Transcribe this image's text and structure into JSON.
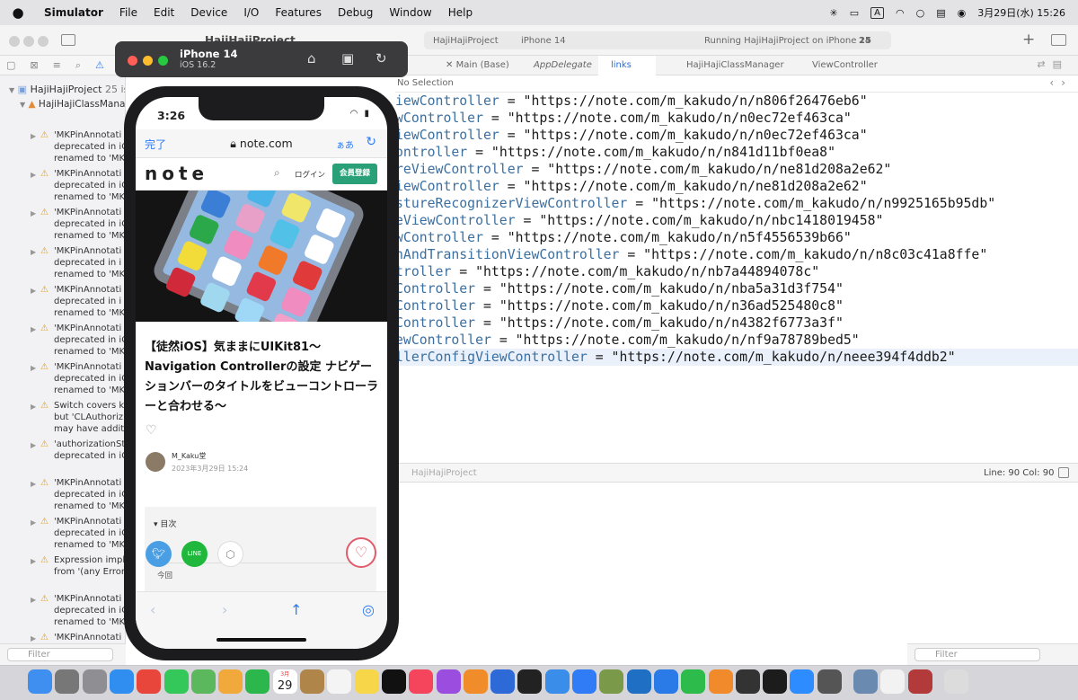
{
  "menubar": {
    "apple": "",
    "app": "Simulator",
    "items": [
      "File",
      "Edit",
      "Device",
      "I/O",
      "Features",
      "Debug",
      "Window",
      "Help"
    ],
    "input": "A",
    "datetime": "3月29日(水)  15:26"
  },
  "xcode": {
    "project": "HajiHajiProject",
    "status_scheme": "HajiHajiProject",
    "status_device": "iPhone 14",
    "status_run": "Running HajiHajiProject on iPhone 14",
    "status_warnings": "25",
    "tabs": [
      "Main (Base)",
      "AppDelegate",
      "links",
      "HajiHajiClassManager",
      "ViewController"
    ],
    "jump_no_selection": "No Selection",
    "debug_path": "HajiHajiProject",
    "line_col": "Line: 90  Col: 90",
    "filter_placeholder": "Filter"
  },
  "issues": {
    "root": "HajiHajiProject",
    "root_count": "25 issues",
    "child": "HajiHajiClassManag",
    "items": [
      {
        "l1": "'MKPinAnnotati",
        "l2": "deprecated in iO",
        "l3": "renamed to 'MK"
      },
      {
        "l1": "'MKPinAnnotati",
        "l2": "deprecated in iO",
        "l3": "renamed to 'MK"
      },
      {
        "l1": "'MKPinAnnotati",
        "l2": "deprecated in iO",
        "l3": "renamed to 'MK"
      },
      {
        "l1": "'MKPinAnnotati",
        "l2": "deprecated in i",
        "l3": "renamed to 'MK"
      },
      {
        "l1": "'MKPinAnnotati",
        "l2": "deprecated in i",
        "l3": "renamed to 'MK"
      },
      {
        "l1": "'MKPinAnnotati",
        "l2": "deprecated in iO",
        "l3": "renamed to 'MK"
      },
      {
        "l1": "'MKPinAnnotati",
        "l2": "deprecated in iO",
        "l3": "renamed to 'MK"
      },
      {
        "l1": "Switch covers k",
        "l2": "but 'CLAuthoriz",
        "l3": "may have additi"
      },
      {
        "l1": "'authorizationSt",
        "l2": "deprecated in iO",
        "l3": ""
      },
      {
        "l1": "'MKPinAnnotati",
        "l2": "deprecated in iO",
        "l3": "renamed to 'MK"
      },
      {
        "l1": "'MKPinAnnotati",
        "l2": "deprecated in iO",
        "l3": "renamed to 'MK"
      },
      {
        "l1": "Expression impl",
        "l2": "from '(any Error",
        "l3": ""
      },
      {
        "l1": "'MKPinAnnotati",
        "l2": "deprecated in iO",
        "l3": "renamed to 'MK"
      },
      {
        "l1": "'MKPinAnnotati",
        "l2": "deprecated in iO",
        "l3": "renamed to 'MK"
      },
      {
        "l1": "'MKPinAnnotati",
        "l2": "deprecated in iO",
        "l3": "renamed to 'MK"
      }
    ]
  },
  "code_lines": [
    {
      "name": "iewController",
      "url": "\"https://note.com/m_kakudo/n/n806f26476eb6\""
    },
    {
      "name": "wController",
      "url": "\"https://note.com/m_kakudo/n/n0ec72ef463ca\""
    },
    {
      "name": "iewController",
      "url": "\"https://note.com/m_kakudo/n/n0ec72ef463ca\""
    },
    {
      "name": "ontroller",
      "url": "\"https://note.com/m_kakudo/n/n841d11bf0ea8\""
    },
    {
      "name": "reViewController",
      "url": "\"https://note.com/m_kakudo/n/ne81d208a2e62\""
    },
    {
      "name": "iewController",
      "url": "\"https://note.com/m_kakudo/n/ne81d208a2e62\""
    },
    {
      "name": "stureRecognizerViewController",
      "url": "\"https://note.com/m_kakudo/n/n9925165b95db\""
    },
    {
      "name": "eViewController",
      "url": "\"https://note.com/m_kakudo/n/nbc1418019458\""
    },
    {
      "name": "wController",
      "url": "\"https://note.com/m_kakudo/n/n5f4556539b66\""
    },
    {
      "name": "nAndTransitionViewController",
      "url": "\"https://note.com/m_kakudo/n/n8c03c41a8ffe\""
    },
    {
      "name": "troller",
      "url": "\"https://note.com/m_kakudo/n/nb7a44894078c\""
    },
    {
      "name": "Controller",
      "url": "\"https://note.com/m_kakudo/n/nba5a31d3f754\""
    },
    {
      "name": "Controller",
      "url": "\"https://note.com/m_kakudo/n/n36ad525480c8\""
    },
    {
      "name": "Controller",
      "url": "\"https://note.com/m_kakudo/n/n4382f6773a3f\""
    },
    {
      "name": "ewController",
      "url": "\"https://note.com/m_kakudo/n/nf9a78789bed5\""
    },
    {
      "name": "llerConfigViewController",
      "url": "\"https://note.com/m_kakudo/n/neee394f4ddb2\""
    }
  ],
  "simulator": {
    "device": "iPhone 14",
    "os": "iOS 16.2"
  },
  "phone": {
    "time": "3:26",
    "done": "完了",
    "url": "note.com",
    "aa": "ぁあ",
    "logo": "note",
    "login": "ログイン",
    "register": "会員登録",
    "title": "【徒然iOS】気ままにUIKit81〜Navigation Controllerの設定 ナビゲーションバーのタイトルをビューコントローラーと合わせる〜",
    "author": "M_Kaku堂",
    "date": "2023年3月29日 15:24",
    "toc": "目次",
    "toc_item": "今回"
  },
  "dock_cal": {
    "month": "3月",
    "day": "29"
  },
  "colors": {
    "accent": "#2f7cf6",
    "note_green": "#2aa078",
    "warning": "#e0a020",
    "code_var": "#3b6fa0"
  }
}
